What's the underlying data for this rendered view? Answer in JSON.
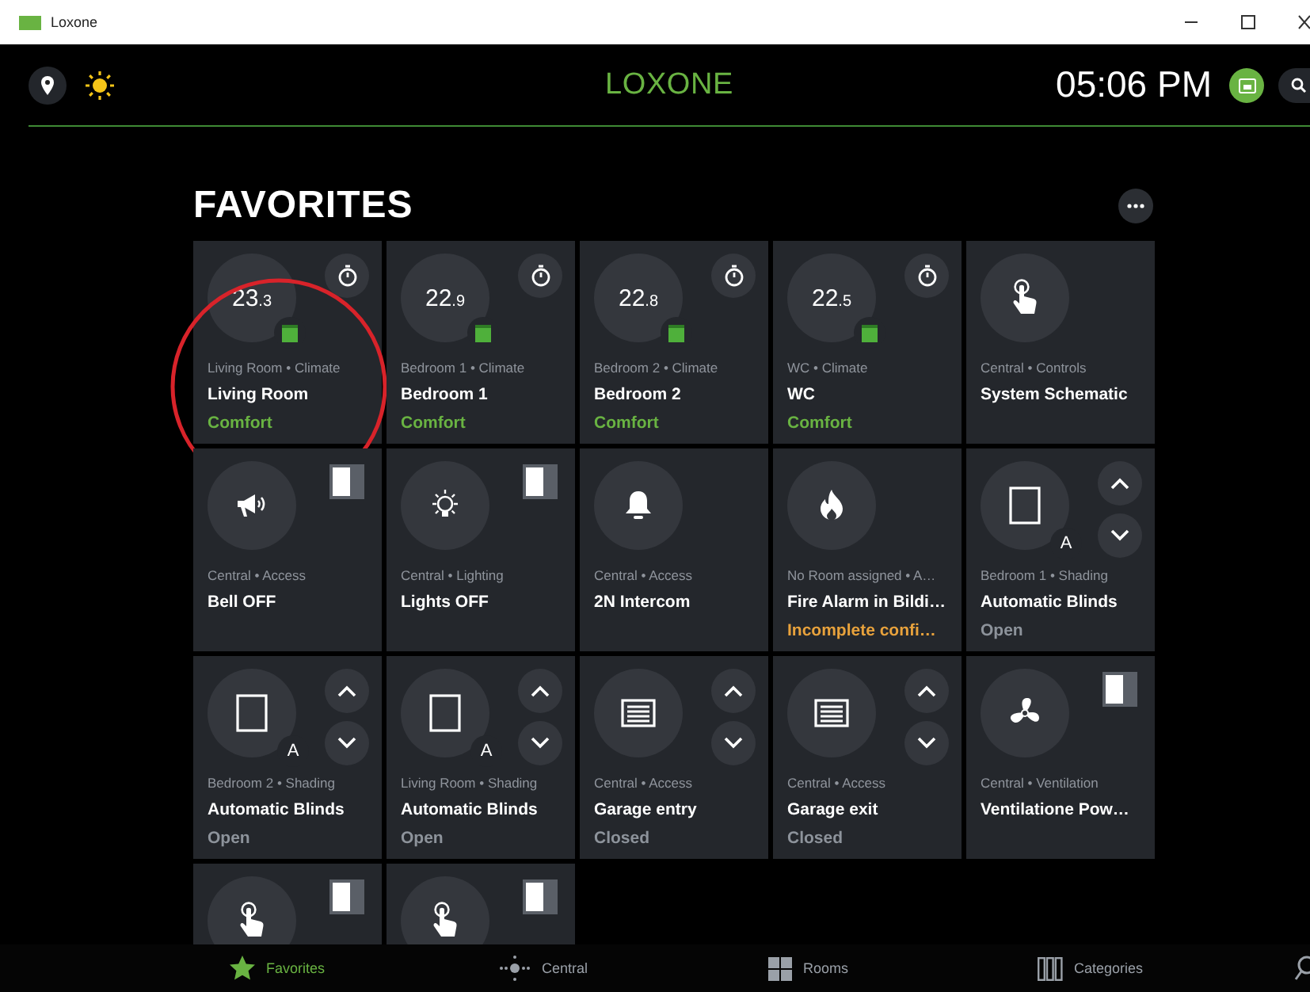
{
  "window": {
    "title": "Loxone"
  },
  "header": {
    "logo": "LOXONE",
    "time": "05:06 PM"
  },
  "page_title": "FAVORITES",
  "tiles": [
    {
      "kind": "climate",
      "temp_whole": "23",
      "temp_fraction": ".3",
      "category": "Living Room • Climate",
      "name": "Living Room",
      "status": "Comfort",
      "color": "#69b342",
      "highlighted": true
    },
    {
      "kind": "climate",
      "temp_whole": "22",
      "temp_fraction": ".9",
      "category": "Bedroom 1 • Climate",
      "name": "Bedroom 1",
      "status": "Comfort",
      "color": "#69b342",
      "highlighted": false
    },
    {
      "kind": "climate",
      "temp_whole": "22",
      "temp_fraction": ".8",
      "category": "Bedroom 2 • Climate",
      "name": "Bedroom 2",
      "status": "Comfort",
      "color": "#69b342",
      "highlighted": false
    },
    {
      "kind": "climate",
      "temp_whole": "22",
      "temp_fraction": ".5",
      "category": "WC • Climate",
      "name": "WC",
      "status": "Comfort",
      "color": "#69b342",
      "highlighted": false
    },
    {
      "kind": "touch",
      "category": "Central • Controls",
      "name": "System Schematic",
      "highlighted": false
    },
    {
      "kind": "speaker",
      "on": false,
      "category": "Central • Access",
      "name": "Bell OFF",
      "highlighted": false
    },
    {
      "kind": "light",
      "on": false,
      "category": "Central • Lighting",
      "name": "Lights OFF",
      "highlighted": false
    },
    {
      "kind": "bell",
      "category": "Central • Access",
      "name": "2N Intercom",
      "highlighted": false
    },
    {
      "kind": "fire",
      "category": "No Room assigned • A…",
      "name": "Fire Alarm in Bildi…",
      "status": "Incomplete confi…",
      "color": "#e8a23c",
      "highlighted": false
    },
    {
      "kind": "blinds",
      "badge": "A",
      "category": "Bedroom 1 • Shading",
      "name": "Automatic Blinds",
      "status": "Open",
      "color": "#8d939b",
      "highlighted": false
    },
    {
      "kind": "blinds",
      "badge": "A",
      "category": "Bedroom 2 • Shading",
      "name": "Automatic Blinds",
      "status": "Open",
      "color": "#8d939b",
      "highlighted": false
    },
    {
      "kind": "blinds",
      "badge": "A",
      "category": "Living Room • Shading",
      "name": "Automatic Blinds",
      "status": "Open",
      "color": "#8d939b",
      "highlighted": false
    },
    {
      "kind": "garage",
      "category": "Central • Access",
      "name": "Garage entry",
      "status": "Closed",
      "color": "#8d939b",
      "highlighted": false
    },
    {
      "kind": "garage",
      "category": "Central • Access",
      "name": "Garage exit",
      "status": "Closed",
      "color": "#8d939b",
      "highlighted": false
    },
    {
      "kind": "fan",
      "on": false,
      "category": "Central • Ventilation",
      "name": "Ventilatione Pow…",
      "highlighted": false
    },
    {
      "kind": "touch",
      "on": false,
      "highlighted": false
    },
    {
      "kind": "touch",
      "on": false,
      "highlighted": false
    }
  ],
  "nav": [
    {
      "label": "Favorites",
      "kind": "star",
      "selected": true
    },
    {
      "label": "Central",
      "kind": "central",
      "selected": false
    },
    {
      "label": "Rooms",
      "kind": "rooms",
      "selected": false
    },
    {
      "label": "Categories",
      "kind": "categories",
      "selected": false
    }
  ]
}
